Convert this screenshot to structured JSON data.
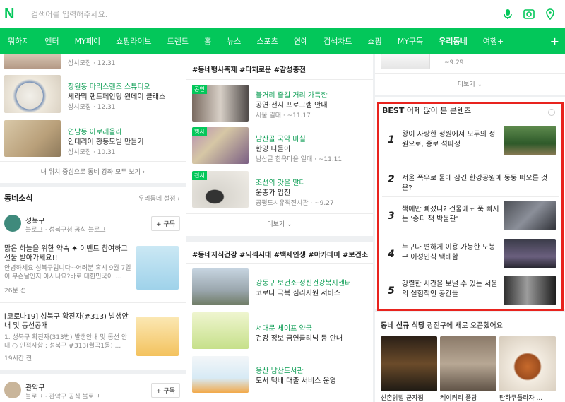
{
  "header": {
    "logo": "N",
    "search_placeholder": "검색어를 입력해주세요."
  },
  "nav": [
    "뭐하지",
    "엔터",
    "MY페이",
    "쇼핑라이브",
    "트렌드",
    "홈",
    "뉴스",
    "스포츠",
    "연예",
    "검색차트",
    "쇼핑",
    "MY구독",
    "우리동네",
    "여행+"
  ],
  "nav_plus": "+",
  "col1": {
    "top_meta": "상시모집 · 12.31",
    "items": [
      {
        "title": "장원동 마리스핸즈 스튜디오",
        "desc": "세라믹 핸드페인팅 원데이 클래스",
        "meta": "상시모집 · 12.31"
      },
      {
        "title": "연남동 아로레올라",
        "desc": "인테리어 황동모빌 만들기",
        "meta": "상시모집 · 10.31"
      }
    ],
    "more_link": "내 위치 중심으로 동네 강좌 모두 보기 ›",
    "news_title": "동네소식",
    "news_setting": "우리동네 설정 ›",
    "author1": {
      "name": "성북구",
      "sub": "블로그 · 성북구청 공식 블로그",
      "follow": "+ 구독"
    },
    "post1": {
      "title": "맑은 하늘을 위한 약속 ✷ 이벤트 참여하고 선물 받아가세요!!",
      "desc": "안녕하세요 성북구입니다~어려분 혹시 9월 7일이 무슨날인지 아시나요?바로 대한민국이 ...",
      "time": "26분 전"
    },
    "post2": {
      "title": "[코로나19] 성북구 확진자(#313) 발생안내 및 동선공개",
      "desc": "1. 성북구 확진자(313번) 발생안내 및 동선 안내 ○ 인적사항 : 성북구 #313(월곡1동) ...",
      "time": "19시간 전"
    },
    "author2": {
      "name": "관악구",
      "sub": "블로그 · 관악구 공식 블로그",
      "follow": "+ 구독"
    }
  },
  "col2": {
    "festival_header": "#동네행사축제  #다채로운 #감성충전",
    "festival": [
      {
        "tag": "공연",
        "title": "불거리 즐길 거리 가득한",
        "desc": "공연·전시 프로그램 안내",
        "meta": "서울 일대 · ~11.17"
      },
      {
        "tag": "행사",
        "title": "남산골 국악 마실",
        "desc": "한양 나들이",
        "meta": "남산골 한옥마을 일대 · ~11.11"
      },
      {
        "tag": "전시",
        "title": "조선의 갓을 말다",
        "desc": "운종가 입전",
        "meta": "공평도시유적전시관 · ~9.27"
      }
    ],
    "more": "더보기 ⌄",
    "health_header": "#동네지식건강  #뇌섹시대 #백세인생 #아카데미 #보건소",
    "health": [
      {
        "title": "강동구 보건소·정신건강복지센터",
        "desc": "코로나 극복 심리지원 서비스"
      },
      {
        "title": "서대문 세이프 약국",
        "desc": "건강 정보·금연클리닉 등 안내"
      },
      {
        "title": "용산 남산도서관",
        "desc": "도서 택배 대출 서비스 운영"
      }
    ]
  },
  "col3": {
    "top_meta": "~9.29",
    "more": "더보기 ⌄",
    "best_label": "BEST",
    "best_title": "어제 많이 본 콘텐츠",
    "best": [
      {
        "n": "1",
        "title": "왕이 사랑한 정원에서 모두의 정원으로, 종로 석파정"
      },
      {
        "n": "2",
        "title": "서울 폭우로 물에 잠긴 한강공원에 둥둥 떠오른 것은?"
      },
      {
        "n": "3",
        "title": "책에만 빠졌니? 건물에도 푹 빠지는 '송파 책 박물관'"
      },
      {
        "n": "4",
        "title": "누구나 편하게 이용 가능한 도봉구 어성인식 택배함"
      },
      {
        "n": "5",
        "title": "강렬한 시간을 보낼 수 있는 서울의 실험적인 공간들"
      }
    ],
    "new_food_title": "동네 신규 식당",
    "new_food_sub": "광진구에 새로 오픈했어요",
    "food": [
      "신촌닭발 군자점",
      "케이커리 풍당",
      "탄하쿠플라자 ..."
    ]
  },
  "colors": {
    "accent": "#03c75a",
    "highlight_border": "#e8231e"
  }
}
